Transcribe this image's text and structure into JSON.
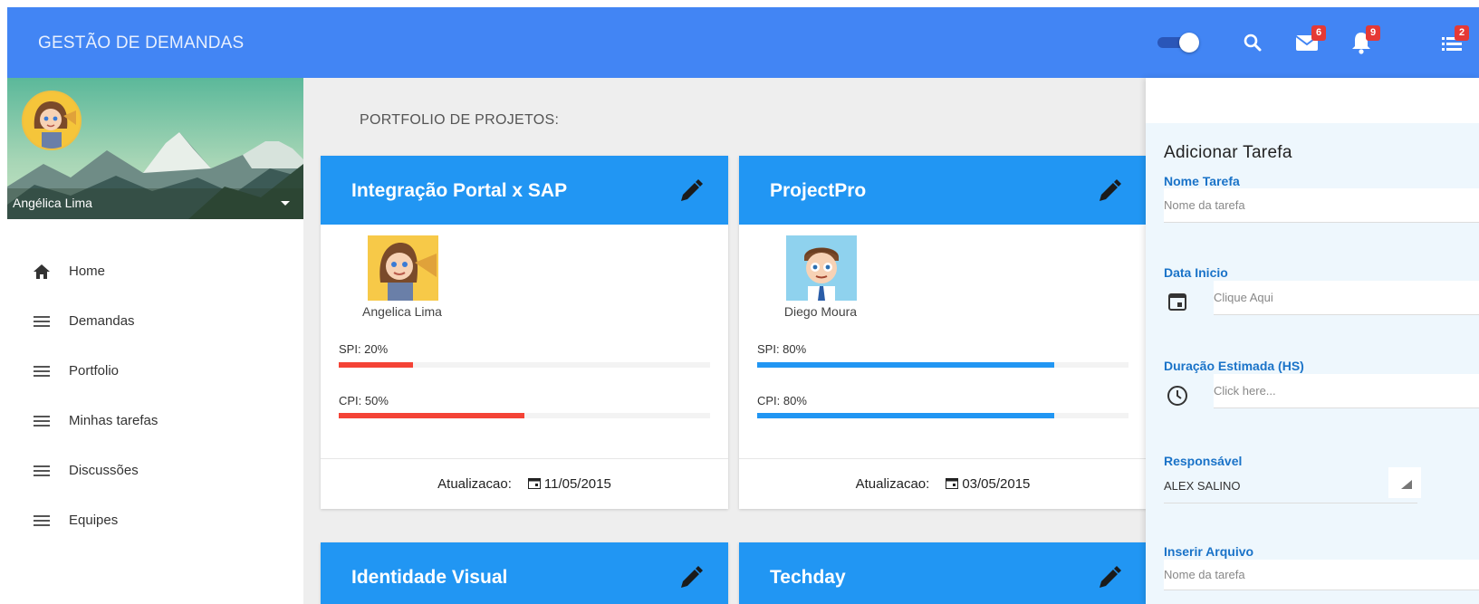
{
  "header": {
    "app_title": "GESTÃO DE DEMANDAS",
    "mail_badge": "6",
    "bell_badge": "9",
    "list_badge": "2",
    "icons": [
      "toggle-switch",
      "search-icon",
      "mail-icon",
      "bell-icon",
      "list-icon"
    ]
  },
  "sidebar": {
    "user_name": "Angélica Lima",
    "items": [
      {
        "label": "Home",
        "icon": "home-icon"
      },
      {
        "label": "Demandas",
        "icon": "menu-icon"
      },
      {
        "label": "Portfolio",
        "icon": "menu-icon"
      },
      {
        "label": "Minhas tarefas",
        "icon": "menu-icon"
      },
      {
        "label": "Discussões",
        "icon": "menu-icon"
      },
      {
        "label": "Equipes",
        "icon": "menu-icon"
      }
    ]
  },
  "main": {
    "section_title": "PORTFOLIO DE PROJETOS:",
    "projects": [
      {
        "title": "Integração Portal x SAP",
        "person": "Angelica Lima",
        "spi_label": "SPI: 20%",
        "spi": 0.2,
        "cpi_label": "CPI: 50%",
        "cpi": 0.5,
        "bar_color": "#f44336",
        "update_label": "Atualizacao:",
        "update_date": "11/05/2015"
      },
      {
        "title": "ProjectPro",
        "person": "Diego Moura",
        "spi_label": "SPI: 80%",
        "spi": 0.8,
        "cpi_label": "CPI: 80%",
        "cpi": 0.8,
        "bar_color": "#2196f3",
        "update_label": "Atualizacao:",
        "update_date": "03/05/2015"
      },
      {
        "title": "Identidade Visual"
      },
      {
        "title": "Techday"
      }
    ]
  },
  "panel": {
    "heading": "Adicionar Tarefa",
    "task_name_label": "Nome Tarefa",
    "task_name_placeholder": "Nome da tarefa",
    "start_date_label": "Data Inicio",
    "start_date_placeholder": "Clique Aqui",
    "duration_label": "Duração Estimada (HS)",
    "duration_placeholder": "Click here...",
    "responsible_label": "Responsável",
    "responsible_value": "ALEX SALINO",
    "file_label": "Inserir Arquivo",
    "file_placeholder": "Nome da tarefa"
  },
  "colors": {
    "topbar": "#4285f4",
    "card_header": "#2196f3",
    "low_metric": "#f44336",
    "high_metric": "#2196f3",
    "panel_label": "#1a73c8"
  }
}
